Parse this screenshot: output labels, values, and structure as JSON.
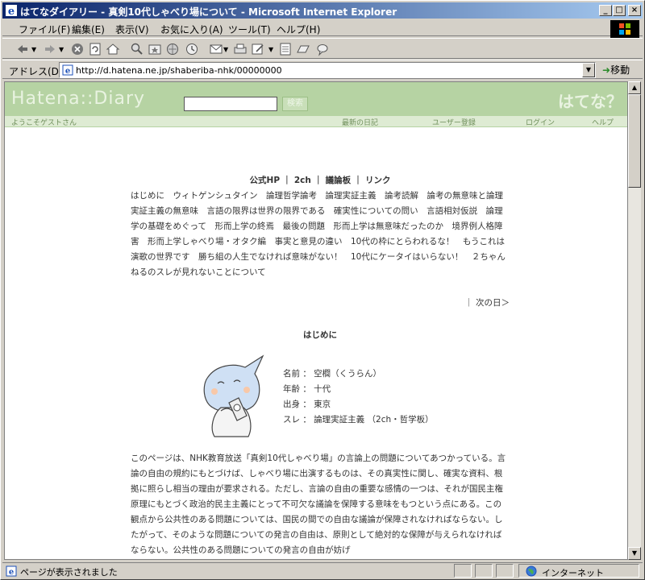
{
  "window": {
    "title": "はてなダイアリー - 真剣10代しゃべり場について - Microsoft Internet Explorer"
  },
  "menu": [
    "ファイル(F)",
    "編集(E)",
    "表示(V)",
    "お気に入り(A)",
    "ツール(T)",
    "ヘルプ(H)"
  ],
  "address": {
    "label": "アドレス(D)",
    "url": "http://d.hatena.ne.jp/shaberiba-nhk/00000000",
    "go_label": "移動"
  },
  "hatena": {
    "logo": "Hatena::Diary",
    "logo_right": "はてな？",
    "search_button": "検索",
    "welcome": "ようこそゲストさん",
    "nav": [
      "最新の日記",
      "ユーザー登録",
      "ログイン",
      "ヘルプ"
    ]
  },
  "page": {
    "index_links": "公式HP ｜ 2ch ｜ 議論板 ｜ リンク",
    "topics": "はじめに　ウィトゲンシュタイン　論理哲学論考　論理実証主義　論考読解　論考の無意味と論理実証主義の無意味　言語の限界は世界の限界である　確実性についての問い　言語相対仮説　論理学の基礎をめぐって　形而上学の終焉　最後の問題　形而上学は無意味だったのか　境界例人格障害　形而上学しゃべり場・オタク編　事実と意見の違い　10代の枠にとらわれるな！　もうこれは演歌の世界です　勝ち組の人生でなければ意味がない！　10代にケータイはいらない！　２ちゃんねるのスレが見れないことについて",
    "next_day": "｜ 次の日＞",
    "section_title": "はじめに",
    "profile": [
      "名前 ： 空櫚（くうらん）",
      "年齢 ： 十代",
      "出身 ： 東京",
      "スレ ： 論理実証主義 （2ch・哲学板）"
    ],
    "paragraph": "このページは、NHK教育放送「真剣10代しゃべり場」の言論上の問題についてあつかっている。言論の自由の規約にもとづけば、しゃべり場に出演するものは、その真実性に関し、確実な資料、根拠に照らし相当の理由が要求される。ただし、言論の自由の重要な感情の一つは、それが国民主権原理にもとづく政治的民主主義にとって不可欠な議論を保障する意味をもつという点にある。この観点から公共性のある問題については、国民の間での自由な議論が保障されなければならない。したがって、そのような問題についての発言の自由は、原則として絶対的な保障が与えられなければならない。公共性のある問題についての発言の自由が妨げ"
  },
  "status": {
    "text": "ページが表示されました",
    "zone": "インターネット"
  }
}
